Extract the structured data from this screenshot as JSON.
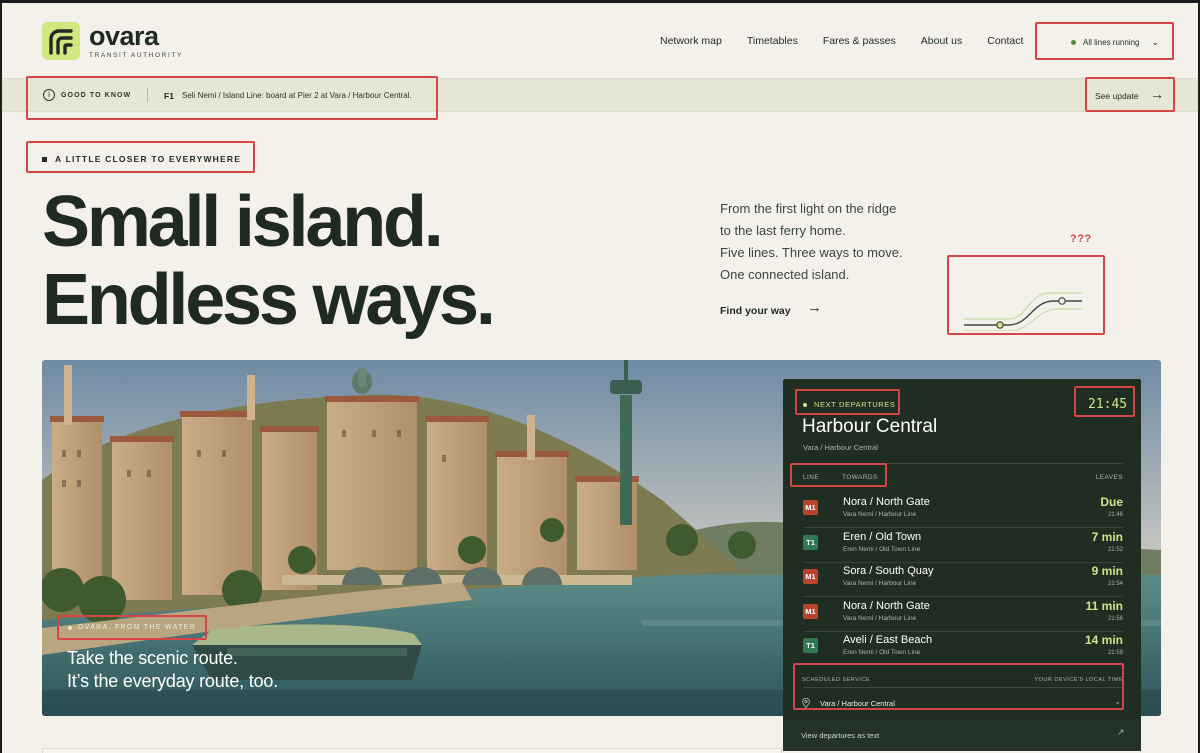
{
  "brand": {
    "name": "ovara",
    "tagline": "TRANSIT AUTHORITY",
    "accent": "#d1e77f",
    "dark": "#1f2a22"
  },
  "nav": {
    "items": [
      "Network map",
      "Timetables",
      "Fares & passes",
      "About us",
      "Contact"
    ],
    "status": "All lines running",
    "status_icon": "chevron-down-icon"
  },
  "notice": {
    "label": "GOOD TO KNOW",
    "code": "F1",
    "text": "Seli Nemi / Island Line: board at Pier 2 at Vara / Harbour Central.",
    "action": "See update",
    "action_icon": "arrow-right-icon"
  },
  "hero": {
    "eyebrow": "A LITTLE CLOSER TO EVERYWHERE",
    "headline_1": "Small island.",
    "headline_2": "Endless ways.",
    "intro": [
      "From the first light on the ridge",
      "to the last ferry home.",
      "Five lines. Three ways to move.",
      "One connected island."
    ],
    "cta": "Find your way",
    "annotation": "???"
  },
  "photo": {
    "tag": "OVARA, FROM THE WATER",
    "caption_1": "Take the scenic route.",
    "caption_2": "It’s the everyday route, too."
  },
  "board": {
    "eyebrow": "NEXT DEPARTURES",
    "clock": "21:45",
    "station": "Harbour Central",
    "station_sub": "Vara / Harbour Central",
    "col_line": "LINE",
    "col_towards": "TOWARDS",
    "col_leaves": "LEAVES",
    "rows": [
      {
        "code": "M1",
        "color": "#b9432d",
        "dest": "Nora / North Gate",
        "line": "Vara Nemi / Harbour Line",
        "eta": "Due",
        "time": "21:46"
      },
      {
        "code": "T1",
        "color": "#2f7a4e",
        "dest": "Eren / Old Town",
        "line": "Eren Nemi / Old Town Line",
        "eta": "7 min",
        "time": "21:52"
      },
      {
        "code": "M1",
        "color": "#b9432d",
        "dest": "Sora / South Quay",
        "line": "Vara Nemi / Harbour Line",
        "eta": "9 min",
        "time": "21:54"
      },
      {
        "code": "M1",
        "color": "#b9432d",
        "dest": "Nora / North Gate",
        "line": "Vara Nemi / Harbour Line",
        "eta": "11 min",
        "time": "21:56"
      },
      {
        "code": "T1",
        "color": "#2f7a4e",
        "dest": "Aveli / East Beach",
        "line": "Eren Nemi / Old Town Line",
        "eta": "14 min",
        "time": "21:59"
      }
    ],
    "sched_label": "SCHEDULED SERVICE",
    "sched_right": "YOUR DEVICE'S LOCAL TIME",
    "stop_value": "Vara / Harbour Central",
    "footer": "View departures as text"
  }
}
